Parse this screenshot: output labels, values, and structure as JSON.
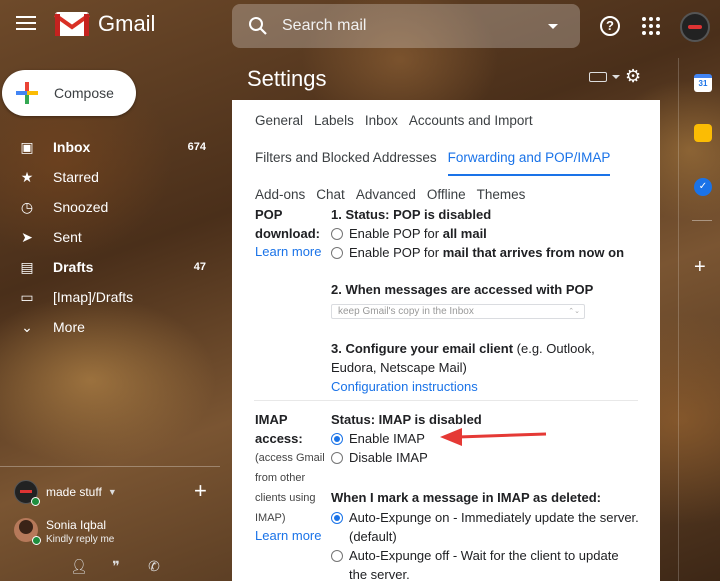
{
  "header": {
    "app_name": "Gmail",
    "search_placeholder": "Search mail"
  },
  "compose": {
    "label": "Compose"
  },
  "sidebar": {
    "items": [
      {
        "label": "Inbox",
        "count": "674",
        "icon": "inbox-icon"
      },
      {
        "label": "Starred",
        "count": "",
        "icon": "star-icon"
      },
      {
        "label": "Snoozed",
        "count": "",
        "icon": "clock-icon"
      },
      {
        "label": "Sent",
        "count": "",
        "icon": "send-icon"
      },
      {
        "label": "Drafts",
        "count": "47",
        "icon": "draft-icon"
      },
      {
        "label": "[Imap]/Drafts",
        "count": "",
        "icon": "label-icon"
      },
      {
        "label": "More",
        "count": "",
        "icon": "chevron-down-icon"
      }
    ]
  },
  "hangouts": {
    "account_name": "made stuff",
    "user_name": "Sonia Iqbal",
    "user_status": "Kindly reply me"
  },
  "settings": {
    "title": "Settings",
    "tabs_row1": [
      "General",
      "Labels",
      "Inbox",
      "Accounts and Import"
    ],
    "tabs_row2": [
      "Filters and Blocked Addresses",
      "Forwarding and POP/IMAP"
    ],
    "tabs_row3": [
      "Add-ons",
      "Chat",
      "Advanced",
      "Offline",
      "Themes"
    ],
    "active_tab": "Forwarding and POP/IMAP",
    "pop": {
      "label_line1": "POP",
      "label_line2": "download:",
      "learn_more": "Learn more",
      "status": "1. Status: POP is disabled",
      "opt1_prefix": "Enable POP for ",
      "opt1_bold": "all mail",
      "opt2_prefix": "Enable POP for ",
      "opt2_bold": "mail that arrives from now on",
      "step2_heading": "2. When messages are accessed with POP",
      "step2_select": "keep Gmail's copy in the Inbox",
      "step3_heading": "3. Configure your email client",
      "step3_rest1": " (e.g. Outlook,",
      "step3_rest2": "Eudora, Netscape Mail)",
      "config_link": "Configuration instructions"
    },
    "imap": {
      "label_line1": "IMAP",
      "label_line2": "access:",
      "note1": "(access Gmail",
      "note2": "from other",
      "note3": "clients using",
      "note4": "IMAP)",
      "learn_more": "Learn more",
      "status": "Status: IMAP is disabled",
      "enable": "Enable IMAP",
      "disable": "Disable IMAP",
      "delete_heading": "When I mark a message in IMAP as deleted:",
      "expunge_on": "Auto-Expunge on - Immediately update the server. (default)",
      "expunge_off": "Auto-Expunge off - Wait for the client to update the server."
    }
  },
  "colors": {
    "accent": "#1a73e8",
    "arrow": "#e53935"
  }
}
